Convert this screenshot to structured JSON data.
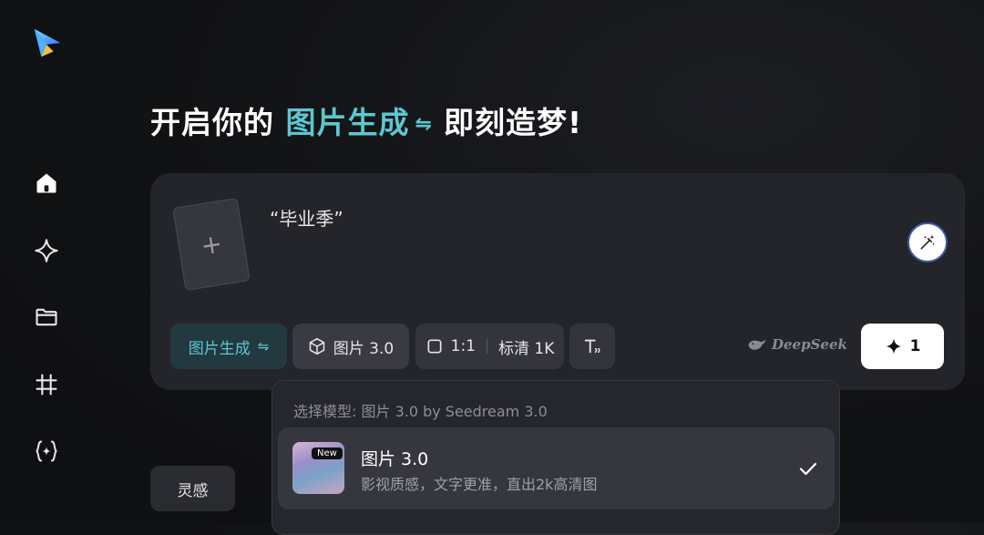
{
  "headline": {
    "prefix": "开启你的",
    "mode": "图片生成",
    "swap_symbol": "⇋",
    "suffix": "即刻造梦!"
  },
  "prompt": {
    "text": "“毕业季”"
  },
  "toolbar": {
    "mode_label": "图片生成",
    "mode_swap": "⇋",
    "model_label": "图片 3.0",
    "ratio_label": "1:1",
    "quality_label": "标清 1K",
    "deepseek_label": "DeepSeek",
    "generate_count": "1"
  },
  "dropdown": {
    "caption": "选择模型: 图片 3.0 by Seedream 3.0",
    "item": {
      "badge": "New",
      "title": "图片 3.0",
      "description": "影视质感，文字更准，直出2k高清图",
      "selected": true
    }
  },
  "inspiration_label": "灵感",
  "sidebar": {
    "items": [
      {
        "icon": "home-icon"
      },
      {
        "icon": "sparkle-icon"
      },
      {
        "icon": "folder-icon"
      },
      {
        "icon": "canvas-icon"
      },
      {
        "icon": "braces-sparkle-icon"
      }
    ]
  },
  "colors": {
    "accent": "#5ec6cf",
    "panel": "#24252b",
    "background": "#111214"
  }
}
